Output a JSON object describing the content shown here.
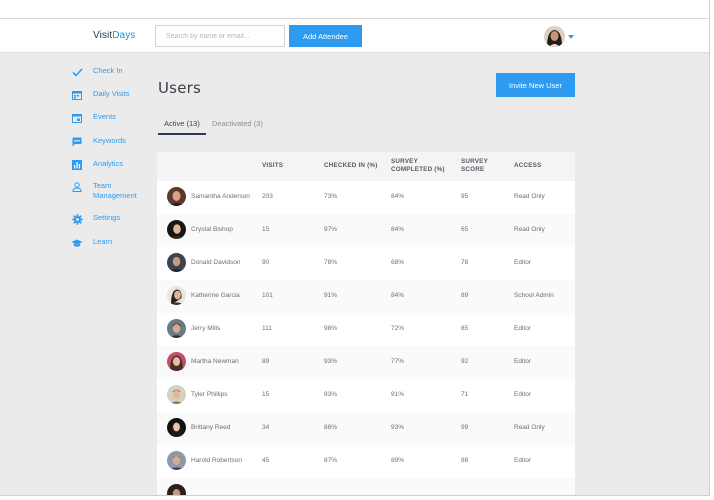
{
  "app": {
    "logo_part1": "Visit",
    "logo_part2": "Days"
  },
  "header": {
    "search_placeholder": "Search by name or email...",
    "add_attendee_label": "Add Attendee"
  },
  "sidebar": {
    "items": [
      {
        "label": "Check In",
        "icon": "checkmark-icon"
      },
      {
        "label": "Daily Visits",
        "icon": "calendar-icon"
      },
      {
        "label": "Events",
        "icon": "calendar-event-icon"
      },
      {
        "label": "Keywords",
        "icon": "chat-bubble-icon"
      },
      {
        "label": "Analytics",
        "icon": "bar-chart-icon"
      },
      {
        "label": "Team Management",
        "icon": "person-icon"
      },
      {
        "label": "Settings",
        "icon": "gear-icon"
      },
      {
        "label": "Learn",
        "icon": "graduation-cap-icon"
      }
    ]
  },
  "main": {
    "title": "Users",
    "invite_label": "Invite New User",
    "tabs": [
      {
        "label": "Active (13)",
        "active": true
      },
      {
        "label": "Deactivated (3)",
        "active": false
      }
    ],
    "columns": [
      "VISITS",
      "CHECKED IN (%)",
      "SURVEY COMPLETED (%)",
      "SURVEY SCORE",
      "ACCESS"
    ],
    "rows": [
      {
        "name": "Samantha Anderson",
        "visits": "203",
        "checked_in": "73%",
        "survey_completed": "84%",
        "score": "95",
        "access": "Read Only"
      },
      {
        "name": "Crystal Bishop",
        "visits": "15",
        "checked_in": "97%",
        "survey_completed": "84%",
        "score": "65",
        "access": "Read Only"
      },
      {
        "name": "Donald Davidson",
        "visits": "90",
        "checked_in": "78%",
        "survey_completed": "68%",
        "score": "78",
        "access": "Editor"
      },
      {
        "name": "Katherine Garcia",
        "visits": "101",
        "checked_in": "91%",
        "survey_completed": "84%",
        "score": "89",
        "access": "School Admin"
      },
      {
        "name": "Jerry Mills",
        "visits": "111",
        "checked_in": "98%",
        "survey_completed": "72%",
        "score": "85",
        "access": "Editor"
      },
      {
        "name": "Martha Newman",
        "visits": "89",
        "checked_in": "93%",
        "survey_completed": "77%",
        "score": "92",
        "access": "Editor"
      },
      {
        "name": "Tyler Phillips",
        "visits": "15",
        "checked_in": "83%",
        "survey_completed": "91%",
        "score": "71",
        "access": "Editor"
      },
      {
        "name": "Brittany Reed",
        "visits": "34",
        "checked_in": "88%",
        "survey_completed": "93%",
        "score": "99",
        "access": "Read Only"
      },
      {
        "name": "Harold Robertson",
        "visits": "45",
        "checked_in": "87%",
        "survey_completed": "89%",
        "score": "88",
        "access": "Editor"
      }
    ]
  },
  "colors": {
    "accent": "#2d9bf0",
    "logo_dark": "#2b3a4f",
    "page_bg": "#ebebeb"
  }
}
